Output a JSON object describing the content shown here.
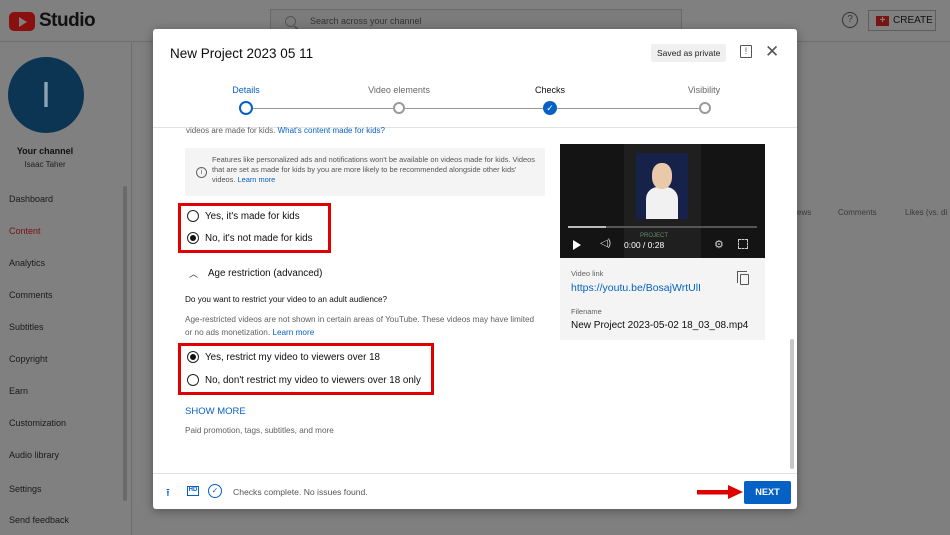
{
  "app": {
    "logo_text": "Studio"
  },
  "header": {
    "search_placeholder": "Search across your channel",
    "help_glyph": "?",
    "create_label": "CREATE"
  },
  "sidebar": {
    "avatar_letter": "I",
    "channel_title": "Your channel",
    "channel_name": "Isaac Taher",
    "items": [
      {
        "label": "Dashboard",
        "active": false
      },
      {
        "label": "Content",
        "active": true
      },
      {
        "label": "Analytics",
        "active": false
      },
      {
        "label": "Comments",
        "active": false
      },
      {
        "label": "Subtitles",
        "active": false
      },
      {
        "label": "Copyright",
        "active": false
      },
      {
        "label": "Earn",
        "active": false
      },
      {
        "label": "Customization",
        "active": false
      },
      {
        "label": "Audio library",
        "active": false
      },
      {
        "label": "Settings",
        "active": false
      },
      {
        "label": "Send feedback",
        "active": false
      }
    ]
  },
  "background_table": {
    "headers": [
      "ews",
      "Comments",
      "Likes (vs. di"
    ]
  },
  "dialog": {
    "title": "New Project 2023 05 11",
    "saved_badge": "Saved as private",
    "steps": [
      {
        "label": "Details",
        "state": "current"
      },
      {
        "label": "Video elements",
        "state": "pending"
      },
      {
        "label": "Checks",
        "state": "done"
      },
      {
        "label": "Visibility",
        "state": "pending"
      }
    ],
    "kids": {
      "top_text": "videos are made for kids.",
      "top_link": "What's content made for kids?",
      "info_text": "Features like personalized ads and notifications won't be available on videos made for kids. Videos that are set as made for kids by you are more likely to be recommended alongside other kids' videos.",
      "info_link": "Learn more",
      "options": [
        {
          "label": "Yes, it's made for kids",
          "selected": false
        },
        {
          "label": "No, it's not made for kids",
          "selected": true
        }
      ]
    },
    "age": {
      "section_title": "Age restriction (advanced)",
      "question": "Do you want to restrict your video to an adult audience?",
      "description": "Age-restricted videos are not shown in certain areas of YouTube. These videos may have limited or no ads monetization.",
      "desc_link": "Learn more",
      "options": [
        {
          "label": "Yes, restrict my video to viewers over 18",
          "selected": true
        },
        {
          "label": "No, don't restrict my video to viewers over 18 only",
          "selected": false
        }
      ]
    },
    "show_more": {
      "label": "SHOW MORE",
      "sub": "Paid promotion, tags, subtitles, and more"
    },
    "video": {
      "time": "0:00 / 0:28",
      "progress": 0.2,
      "overlay_logo": "PROJECT",
      "link_label": "Video link",
      "link": "https://youtu.be/BosajWrtUlI",
      "filename_label": "Filename",
      "filename": "New Project 2023-05-02 18_03_08.mp4"
    },
    "footer": {
      "hd_label": "HD",
      "status": "Checks complete. No issues found.",
      "next_label": "NEXT"
    }
  },
  "colors": {
    "accent": "#0661c4",
    "highlight": "#e00000",
    "overlay": "#7f7f7f"
  }
}
